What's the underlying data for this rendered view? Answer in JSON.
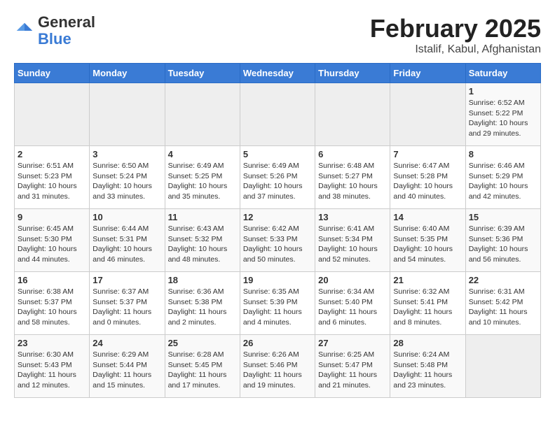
{
  "header": {
    "logo_general": "General",
    "logo_blue": "Blue",
    "month_year": "February 2025",
    "location": "Istalif, Kabul, Afghanistan"
  },
  "days_of_week": [
    "Sunday",
    "Monday",
    "Tuesday",
    "Wednesday",
    "Thursday",
    "Friday",
    "Saturday"
  ],
  "weeks": [
    [
      {
        "day": "",
        "info": ""
      },
      {
        "day": "",
        "info": ""
      },
      {
        "day": "",
        "info": ""
      },
      {
        "day": "",
        "info": ""
      },
      {
        "day": "",
        "info": ""
      },
      {
        "day": "",
        "info": ""
      },
      {
        "day": "1",
        "info": "Sunrise: 6:52 AM\nSunset: 5:22 PM\nDaylight: 10 hours and 29 minutes."
      }
    ],
    [
      {
        "day": "2",
        "info": "Sunrise: 6:51 AM\nSunset: 5:23 PM\nDaylight: 10 hours and 31 minutes."
      },
      {
        "day": "3",
        "info": "Sunrise: 6:50 AM\nSunset: 5:24 PM\nDaylight: 10 hours and 33 minutes."
      },
      {
        "day": "4",
        "info": "Sunrise: 6:49 AM\nSunset: 5:25 PM\nDaylight: 10 hours and 35 minutes."
      },
      {
        "day": "5",
        "info": "Sunrise: 6:49 AM\nSunset: 5:26 PM\nDaylight: 10 hours and 37 minutes."
      },
      {
        "day": "6",
        "info": "Sunrise: 6:48 AM\nSunset: 5:27 PM\nDaylight: 10 hours and 38 minutes."
      },
      {
        "day": "7",
        "info": "Sunrise: 6:47 AM\nSunset: 5:28 PM\nDaylight: 10 hours and 40 minutes."
      },
      {
        "day": "8",
        "info": "Sunrise: 6:46 AM\nSunset: 5:29 PM\nDaylight: 10 hours and 42 minutes."
      }
    ],
    [
      {
        "day": "9",
        "info": "Sunrise: 6:45 AM\nSunset: 5:30 PM\nDaylight: 10 hours and 44 minutes."
      },
      {
        "day": "10",
        "info": "Sunrise: 6:44 AM\nSunset: 5:31 PM\nDaylight: 10 hours and 46 minutes."
      },
      {
        "day": "11",
        "info": "Sunrise: 6:43 AM\nSunset: 5:32 PM\nDaylight: 10 hours and 48 minutes."
      },
      {
        "day": "12",
        "info": "Sunrise: 6:42 AM\nSunset: 5:33 PM\nDaylight: 10 hours and 50 minutes."
      },
      {
        "day": "13",
        "info": "Sunrise: 6:41 AM\nSunset: 5:34 PM\nDaylight: 10 hours and 52 minutes."
      },
      {
        "day": "14",
        "info": "Sunrise: 6:40 AM\nSunset: 5:35 PM\nDaylight: 10 hours and 54 minutes."
      },
      {
        "day": "15",
        "info": "Sunrise: 6:39 AM\nSunset: 5:36 PM\nDaylight: 10 hours and 56 minutes."
      }
    ],
    [
      {
        "day": "16",
        "info": "Sunrise: 6:38 AM\nSunset: 5:37 PM\nDaylight: 10 hours and 58 minutes."
      },
      {
        "day": "17",
        "info": "Sunrise: 6:37 AM\nSunset: 5:37 PM\nDaylight: 11 hours and 0 minutes."
      },
      {
        "day": "18",
        "info": "Sunrise: 6:36 AM\nSunset: 5:38 PM\nDaylight: 11 hours and 2 minutes."
      },
      {
        "day": "19",
        "info": "Sunrise: 6:35 AM\nSunset: 5:39 PM\nDaylight: 11 hours and 4 minutes."
      },
      {
        "day": "20",
        "info": "Sunrise: 6:34 AM\nSunset: 5:40 PM\nDaylight: 11 hours and 6 minutes."
      },
      {
        "day": "21",
        "info": "Sunrise: 6:32 AM\nSunset: 5:41 PM\nDaylight: 11 hours and 8 minutes."
      },
      {
        "day": "22",
        "info": "Sunrise: 6:31 AM\nSunset: 5:42 PM\nDaylight: 11 hours and 10 minutes."
      }
    ],
    [
      {
        "day": "23",
        "info": "Sunrise: 6:30 AM\nSunset: 5:43 PM\nDaylight: 11 hours and 12 minutes."
      },
      {
        "day": "24",
        "info": "Sunrise: 6:29 AM\nSunset: 5:44 PM\nDaylight: 11 hours and 15 minutes."
      },
      {
        "day": "25",
        "info": "Sunrise: 6:28 AM\nSunset: 5:45 PM\nDaylight: 11 hours and 17 minutes."
      },
      {
        "day": "26",
        "info": "Sunrise: 6:26 AM\nSunset: 5:46 PM\nDaylight: 11 hours and 19 minutes."
      },
      {
        "day": "27",
        "info": "Sunrise: 6:25 AM\nSunset: 5:47 PM\nDaylight: 11 hours and 21 minutes."
      },
      {
        "day": "28",
        "info": "Sunrise: 6:24 AM\nSunset: 5:48 PM\nDaylight: 11 hours and 23 minutes."
      },
      {
        "day": "",
        "info": ""
      }
    ]
  ]
}
